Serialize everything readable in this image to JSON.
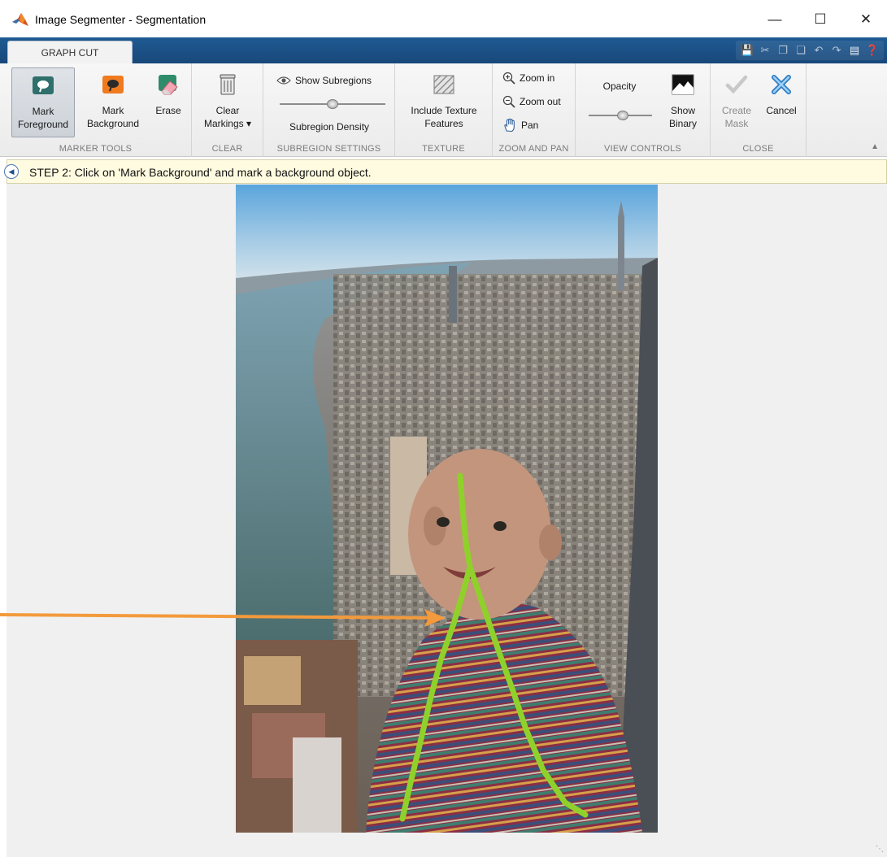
{
  "window": {
    "title": "Image Segmenter - Segmentation",
    "minimize_glyph": "—",
    "maximize_glyph": "☐",
    "close_glyph": "✕"
  },
  "tabs": [
    {
      "label": "GRAPH CUT",
      "active": true
    }
  ],
  "ribbon": {
    "marker_tools": {
      "label": "MARKER TOOLS",
      "mark_foreground": {
        "line1": "Mark",
        "line2": "Foreground",
        "pressed": true
      },
      "mark_background": {
        "line1": "Mark",
        "line2": "Background"
      },
      "erase": {
        "line1": "Erase"
      }
    },
    "clear": {
      "label": "CLEAR",
      "clear_markings": {
        "line1": "Clear",
        "line2": "Markings ▾"
      }
    },
    "subregion_settings": {
      "label": "SUBREGION SETTINGS",
      "show_subregions": "Show Subregions",
      "subregion_density": "Subregion Density",
      "density_level": 0.5
    },
    "texture": {
      "label": "TEXTURE",
      "include_texture": {
        "line1": "Include Texture",
        "line2": "Features"
      }
    },
    "zoom_and_pan": {
      "label": "ZOOM AND PAN",
      "zoom_in": "Zoom in",
      "zoom_out": "Zoom out",
      "pan": "Pan"
    },
    "view_controls": {
      "label": "VIEW CONTROLS",
      "opacity": "Opacity",
      "opacity_level": 0.55,
      "show_binary": {
        "line1": "Show",
        "line2": "Binary"
      }
    },
    "close": {
      "label": "CLOSE",
      "create_mask": {
        "line1": "Create",
        "line2": "Mask",
        "enabled": false
      },
      "cancel": {
        "line1": "Cancel"
      }
    }
  },
  "instruction": {
    "text": "STEP 2: Click on 'Mark Background' and mark a background object."
  },
  "colors": {
    "tab_strip": "#1f5a93",
    "foreground_marking": "#8fd12a",
    "annotation_arrow": "#f39a3c",
    "info_bar": "#fffbe0"
  }
}
